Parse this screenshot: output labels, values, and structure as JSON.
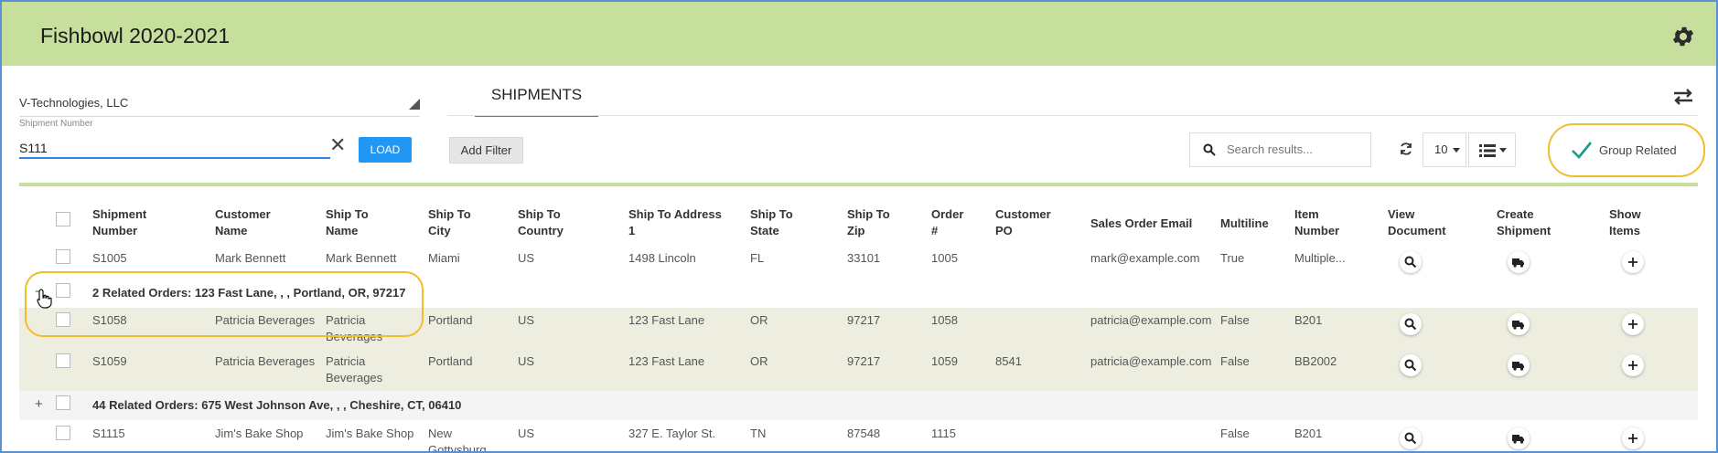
{
  "header": {
    "title": "Fishbowl 2020-2021"
  },
  "left": {
    "company": "V-Technologies, LLC",
    "shipment_label": "Shipment Number",
    "shipment_value": "S111",
    "clear": "✕",
    "load_label": "LOAD"
  },
  "tabs": [
    {
      "label": "SHIPMENTS"
    }
  ],
  "toolbar": {
    "add_filter": "Add Filter",
    "search_placeholder": "Search results...",
    "page_size": "10",
    "group_related": "Group Related"
  },
  "columns": [
    {
      "label1": "Shipment",
      "label2": "Number"
    },
    {
      "label1": "Customer",
      "label2": "Name"
    },
    {
      "label1": "Ship To",
      "label2": "Name"
    },
    {
      "label1": "Ship To",
      "label2": "City"
    },
    {
      "label1": "Ship To",
      "label2": "Country"
    },
    {
      "label1": "Ship To Address",
      "label2": "1"
    },
    {
      "label1": "Ship To",
      "label2": "State"
    },
    {
      "label1": "Ship To",
      "label2": "Zip"
    },
    {
      "label1": "Order",
      "label2": "#"
    },
    {
      "label1": "Customer",
      "label2": "PO"
    },
    {
      "label1": "Sales Order Email",
      "label2": ""
    },
    {
      "label1": "Multiline",
      "label2": ""
    },
    {
      "label1": "Item",
      "label2": "Number"
    },
    {
      "label1": "View",
      "label2": "Document"
    },
    {
      "label1": "Create",
      "label2": "Shipment"
    },
    {
      "label1": "Show",
      "label2": "Items"
    }
  ],
  "rows": [
    {
      "shipment": "S1005",
      "customer": "Mark Bennett",
      "shipto_name1": "Mark Bennett",
      "shipto_name2": "",
      "city1": "Miami",
      "city2": "",
      "country": "US",
      "address": "1498 Lincoln",
      "state": "FL",
      "zip": "33101",
      "order": "1005",
      "po": "",
      "email": "mark@example.com",
      "multiline": "True",
      "item": "Multiple..."
    },
    {
      "shipment": "S1058",
      "customer": "Patricia Beverages",
      "shipto_name1": "Patricia",
      "shipto_name2": "Beverages",
      "city1": "Portland",
      "city2": "",
      "country": "US",
      "address": "123 Fast Lane",
      "state": "OR",
      "zip": "97217",
      "order": "1058",
      "po": "",
      "email": "patricia@example.com",
      "multiline": "False",
      "item": "B201"
    },
    {
      "shipment": "S1059",
      "customer": "Patricia Beverages",
      "shipto_name1": "Patricia",
      "shipto_name2": "Beverages",
      "city1": "Portland",
      "city2": "",
      "country": "US",
      "address": "123 Fast Lane",
      "state": "OR",
      "zip": "97217",
      "order": "1059",
      "po": "8541",
      "email": "patricia@example.com",
      "multiline": "False",
      "item": "BB2002"
    },
    {
      "shipment": "S1115",
      "customer": "Jim's Bake Shop",
      "shipto_name1": "Jim's Bake Shop",
      "shipto_name2": "",
      "city1": "New",
      "city2": "Gottysburg",
      "country": "US",
      "address": "327 E. Taylor St.",
      "state": "TN",
      "zip": "87548",
      "order": "1115",
      "po": "",
      "email": "",
      "multiline": "False",
      "item": "B201"
    }
  ],
  "groups": [
    {
      "label": "2 Related Orders: 123 Fast Lane, , , Portland, OR, 97217",
      "toggle": "−"
    },
    {
      "label": "44 Related Orders: 675 West Johnson Ave, , , Cheshire, CT, 06410",
      "toggle": "+"
    }
  ],
  "colors": {
    "header_bg": "#c6df9d",
    "accent": "#2196f3",
    "highlight": "#f0bd2b",
    "group_row_bg": "#eeeee0"
  }
}
